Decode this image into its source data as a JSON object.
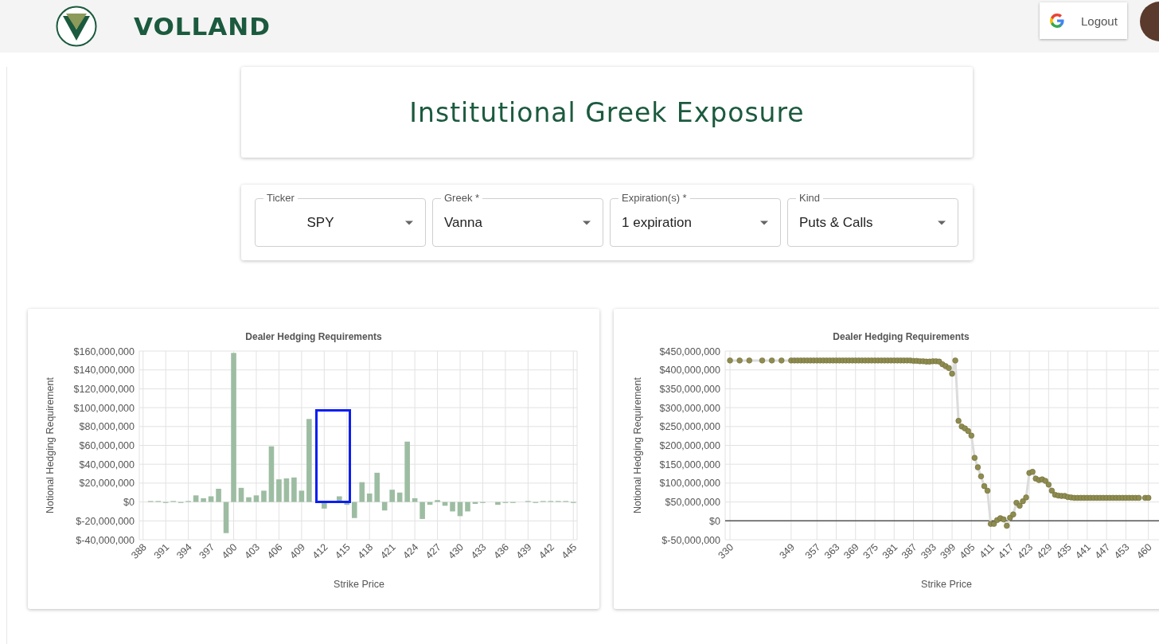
{
  "header": {
    "brand": "VOLLAND",
    "logout_button": "Logout"
  },
  "title": "Institutional Greek Exposure",
  "filters": [
    {
      "label": "Ticker",
      "value": "SPY"
    },
    {
      "label": "Greek *",
      "value": "Vanna"
    },
    {
      "label": "Expiration(s) *",
      "value": "1 expiration"
    },
    {
      "label": "Kind",
      "value": "Puts & Calls"
    }
  ],
  "charts": [
    {
      "chart_data": {
        "type": "bar",
        "title": "Dealer Hedging Requirements",
        "xlabel": "Strike Price",
        "ylabel": "Notional Hedging Requirement",
        "grid": true,
        "x": [
          388,
          389,
          390,
          391,
          392,
          393,
          394,
          395,
          396,
          397,
          398,
          399,
          400,
          401,
          402,
          403,
          404,
          405,
          406,
          407,
          408,
          409,
          410,
          411,
          412,
          413,
          414,
          415,
          416,
          417,
          418,
          419,
          420,
          421,
          422,
          423,
          424,
          425,
          426,
          427,
          428,
          429,
          430,
          431,
          432,
          433,
          434,
          435,
          436,
          437,
          438,
          439,
          440,
          441,
          442,
          443,
          444,
          445
        ],
        "xlim": [
          387.5,
          445.5
        ],
        "series": [
          {
            "color": "#9dbda2",
            "values": [
              0,
              1000000,
              1000000,
              -1000000,
              1000000,
              -1000000,
              1000000,
              7000000,
              4000000,
              6000000,
              14000000,
              -33000000,
              158000000,
              15000000,
              5000000,
              7000000,
              12000000,
              59000000,
              24000000,
              25000000,
              26000000,
              12000000,
              88000000,
              0,
              -7000000,
              0,
              6000000,
              -3000000,
              -17000000,
              21000000,
              9000000,
              31000000,
              -9000000,
              13000000,
              10000000,
              64000000,
              4000000,
              -18000000,
              -3000000,
              2000000,
              -4000000,
              -10000000,
              -15000000,
              -10000000,
              -2000000,
              -1000000,
              0,
              -3000000,
              -1000000,
              -1000000,
              0,
              1000000,
              -1000000,
              1000000,
              1000000,
              1000000,
              1000000,
              -1000000
            ]
          }
        ],
        "ylim": [
          -40000000,
          160000000
        ],
        "xticks": [
          388,
          391,
          394,
          397,
          400,
          403,
          406,
          409,
          412,
          415,
          418,
          421,
          424,
          427,
          430,
          433,
          436,
          439,
          442,
          445
        ],
        "yticks": [
          {
            "value": -40000000,
            "label": "$-40,000,000"
          },
          {
            "value": -20000000,
            "label": "$-20,000,000"
          },
          {
            "value": 0,
            "label": "$0"
          },
          {
            "value": 20000000,
            "label": "$20,000,000"
          },
          {
            "value": 40000000,
            "label": "$40,000,000"
          },
          {
            "value": 60000000,
            "label": "$60,000,000"
          },
          {
            "value": 80000000,
            "label": "$80,000,000"
          },
          {
            "value": 100000000,
            "label": "$100,000,000"
          },
          {
            "value": 120000000,
            "label": "$120,000,000"
          },
          {
            "value": 140000000,
            "label": "$140,000,000"
          },
          {
            "value": 160000000,
            "label": "$160,000,000"
          }
        ]
      }
    },
    {
      "chart_data": {
        "type": "line",
        "title": "Dealer Hedging Requirements",
        "xlabel": "Strike Price",
        "ylabel": "Notional Hedging Requirement",
        "grid": true,
        "x": [
          330,
          333,
          336,
          340,
          343,
          346,
          349,
          350,
          351,
          352,
          353,
          354,
          355,
          356,
          357,
          358,
          359,
          360,
          361,
          362,
          363,
          364,
          365,
          366,
          367,
          368,
          369,
          370,
          371,
          372,
          373,
          374,
          375,
          376,
          377,
          378,
          379,
          380,
          381,
          382,
          383,
          384,
          385,
          386,
          387,
          388,
          389,
          390,
          391,
          392,
          393,
          394,
          395,
          396,
          397,
          398,
          399,
          400,
          401,
          402,
          403,
          404,
          405,
          406,
          407,
          408,
          409,
          410,
          411,
          412,
          413,
          414,
          415,
          416,
          417,
          418,
          419,
          420,
          421,
          422,
          423,
          424,
          425,
          426,
          427,
          428,
          429,
          430,
          431,
          432,
          433,
          434,
          435,
          436,
          437,
          438,
          439,
          440,
          441,
          442,
          443,
          444,
          445,
          446,
          447,
          448,
          449,
          450,
          451,
          452,
          453,
          454,
          455,
          456,
          457,
          459,
          460
        ],
        "xlim": [
          328.5,
          467
        ],
        "series": [
          {
            "color": "#8e8c4f",
            "marker": "o",
            "values": [
              425000000,
              425000000,
              425000000,
              425000000,
              425000000,
              425000000,
              425000000,
              425000000,
              425000000,
              425000000,
              425000000,
              425000000,
              425000000,
              425000000,
              425000000,
              425000000,
              425000000,
              425000000,
              425000000,
              425000000,
              425000000,
              425000000,
              425000000,
              425000000,
              425000000,
              425000000,
              425000000,
              425000000,
              425000000,
              425000000,
              425000000,
              425000000,
              425000000,
              425000000,
              425000000,
              425000000,
              425000000,
              425000000,
              425000000,
              425000000,
              425000000,
              425000000,
              425000000,
              425000000,
              424000000,
              424000000,
              423000000,
              423000000,
              422000000,
              422000000,
              423000000,
              423000000,
              422000000,
              415000000,
              410000000,
              405000000,
              390000000,
              425000000,
              265000000,
              250000000,
              245000000,
              238000000,
              226000000,
              167000000,
              142000000,
              118000000,
              92000000,
              80000000,
              -8000000,
              -8000000,
              2000000,
              7000000,
              4000000,
              -13000000,
              8000000,
              17000000,
              48000000,
              40000000,
              52000000,
              62000000,
              127000000,
              130000000,
              112000000,
              108000000,
              110000000,
              106000000,
              96000000,
              80000000,
              69000000,
              67000000,
              66000000,
              66000000,
              63000000,
              62000000,
              61000000,
              61000000,
              61000000,
              61000000,
              61000000,
              61000000,
              61000000,
              61000000,
              61000000,
              61000000,
              61000000,
              61000000,
              61000000,
              61000000,
              61000000,
              61000000,
              61000000,
              61000000,
              61000000,
              61000000,
              61000000,
              61000000,
              61000000
            ]
          }
        ],
        "ylim": [
          -50000000,
          450000000
        ],
        "xticks": [
          330,
          349,
          357,
          363,
          369,
          375,
          381,
          387,
          393,
          399,
          405,
          411,
          417,
          423,
          429,
          435,
          441,
          447,
          453,
          460
        ],
        "yticks": [
          {
            "value": -50000000,
            "label": "$-50,000,000"
          },
          {
            "value": 0,
            "label": "$0"
          },
          {
            "value": 50000000,
            "label": "$50,000,000"
          },
          {
            "value": 100000000,
            "label": "$100,000,000"
          },
          {
            "value": 150000000,
            "label": "$150,000,000"
          },
          {
            "value": 200000000,
            "label": "$200,000,000"
          },
          {
            "value": 250000000,
            "label": "$250,000,000"
          },
          {
            "value": 300000000,
            "label": "$300,000,000"
          },
          {
            "value": 350000000,
            "label": "$350,000,000"
          },
          {
            "value": 400000000,
            "label": "$400,000,000"
          },
          {
            "value": 450000000,
            "label": "$450,000,000"
          }
        ]
      }
    }
  ]
}
